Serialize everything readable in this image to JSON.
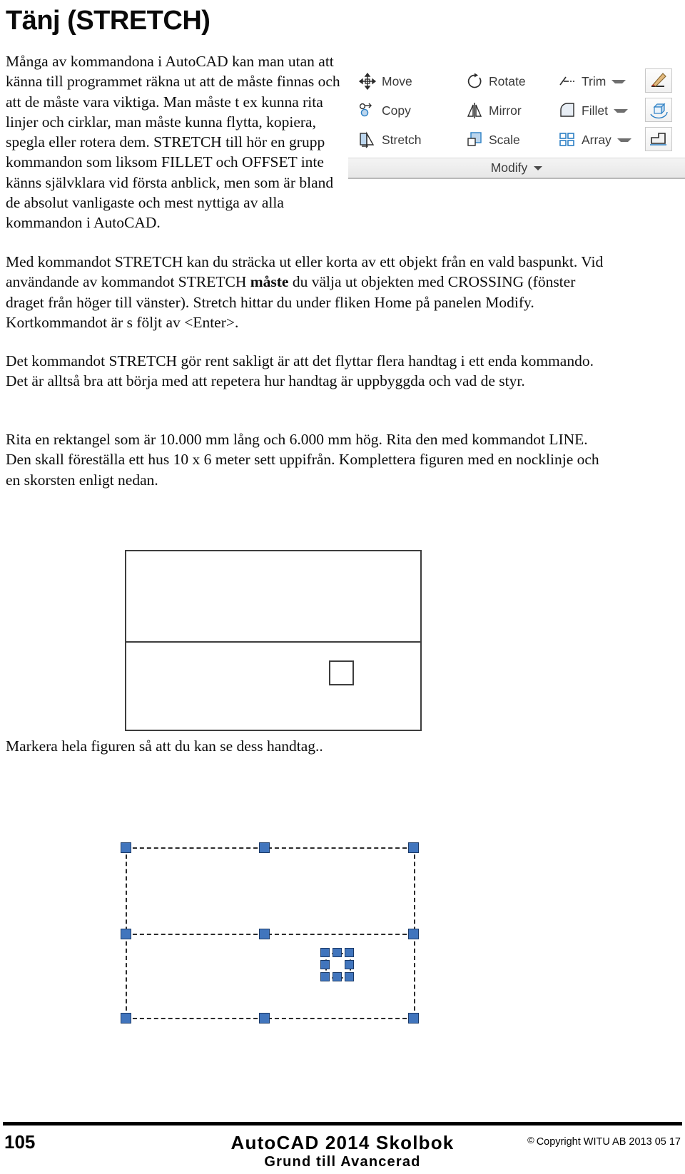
{
  "page": {
    "title": "Tänj (STRETCH)",
    "language": "sv"
  },
  "paragraphs": {
    "intro_narrow": "Många av kommandona i AutoCAD kan man utan att känna till programmet räkna ut att de måste finnas och att de måste vara viktiga. Man måste t ex kunna rita linjer och cirklar, man måste kunna flytta, kopiera, spegla eller rotera dem. STRETCH till hör en grupp kommandon som liksom FILLET och OFFSET inte känns självklara vid första anblick, men som är bland de absolut vanligaste och mest nyttiga av alla kommandon i AutoCAD.",
    "p2_a": "Med kommandot STRETCH kan du sträcka ut eller korta av ett objekt från en vald baspunkt. Vid användande av kommandot STRETCH ",
    "p2_bold": "måste",
    "p2_b": " du välja ut objekten med CROSSING (fönster draget från höger till vänster). Stretch hittar du under fliken Home på panelen Modify. Kortkommandot är s följt av <Enter>.",
    "p3": "Det kommandot STRETCH gör rent sakligt är att det flyttar flera handtag i ett enda kommando. Det är alltså bra att börja med att repetera hur handtag är uppbyggda och vad de styr.",
    "p4": "Rita en rektangel som är 10.000 mm lång och 6.000 mm hög. Rita den med kommandot LINE. Den skall föreställa ett hus 10 x 6 meter sett uppifrån. Komplettera figuren med en nocklinje och en skorsten enligt nedan.",
    "caption": "Markera hela figuren så att du kan se dess handtag.."
  },
  "ribbon": {
    "panel_label": "Modify",
    "items": [
      {
        "label": "Move",
        "icon": "move-icon",
        "has_caret": false
      },
      {
        "label": "Rotate",
        "icon": "rotate-icon",
        "has_caret": false
      },
      {
        "label": "Trim",
        "icon": "trim-icon",
        "has_caret": true
      },
      {
        "label": "Copy",
        "icon": "copy-icon",
        "has_caret": false
      },
      {
        "label": "Mirror",
        "icon": "mirror-icon",
        "has_caret": false
      },
      {
        "label": "Fillet",
        "icon": "fillet-icon",
        "has_caret": true
      },
      {
        "label": "Stretch",
        "icon": "stretch-icon",
        "has_caret": false
      },
      {
        "label": "Scale",
        "icon": "scale-icon",
        "has_caret": false
      },
      {
        "label": "Array",
        "icon": "array-icon",
        "has_caret": true
      }
    ],
    "side_buttons": [
      {
        "icon": "match-properties-icon"
      },
      {
        "icon": "rotate-3d-icon"
      },
      {
        "icon": "extrude-icon"
      }
    ]
  },
  "drawing": {
    "shape": "house-plan-rectangle",
    "width_mm": "10.000",
    "height_mm": "6.000",
    "features": [
      "rectangle",
      "ridge-line",
      "chimney-square"
    ]
  },
  "selection": {
    "grip_color": "#4175bd",
    "grip_count_outline": 6,
    "grip_count_chimney": 8
  },
  "footer": {
    "page_number": "105",
    "title": "AutoCAD 2014 Skolbok",
    "subtitle": "Grund till Avancerad",
    "copyright_mark": "©",
    "copyright": "Copyright WITU AB 2013 05 17"
  }
}
